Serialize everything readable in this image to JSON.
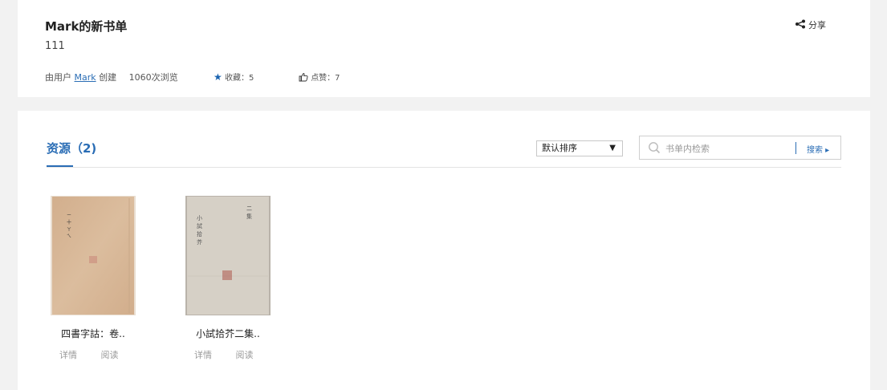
{
  "header": {
    "title": "Mark的新书单",
    "subtitle": "111",
    "creator_prefix": "由用户",
    "creator_name": "Mark",
    "creator_suffix": "创建",
    "views": "1060次浏览",
    "favorites": "收藏：5",
    "likes": "点赞：7",
    "share_label": "分享"
  },
  "resources": {
    "title": "资源（2)",
    "sort": {
      "selected": "默认排序"
    },
    "search": {
      "placeholder": "书单内检索",
      "button_label": "搜索 ▸"
    },
    "books": [
      {
        "name": "四書字詁：卷..",
        "detail_label": "详情",
        "read_label": "阅读"
      },
      {
        "name": "小試拾芥二集..",
        "detail_label": "详情",
        "read_label": "阅读"
      }
    ]
  },
  "colors": {
    "accent": "#2a6db5",
    "page_bg": "#f2f2f2",
    "cover1": "#d8b898",
    "cover2": "#d6d0c6"
  }
}
